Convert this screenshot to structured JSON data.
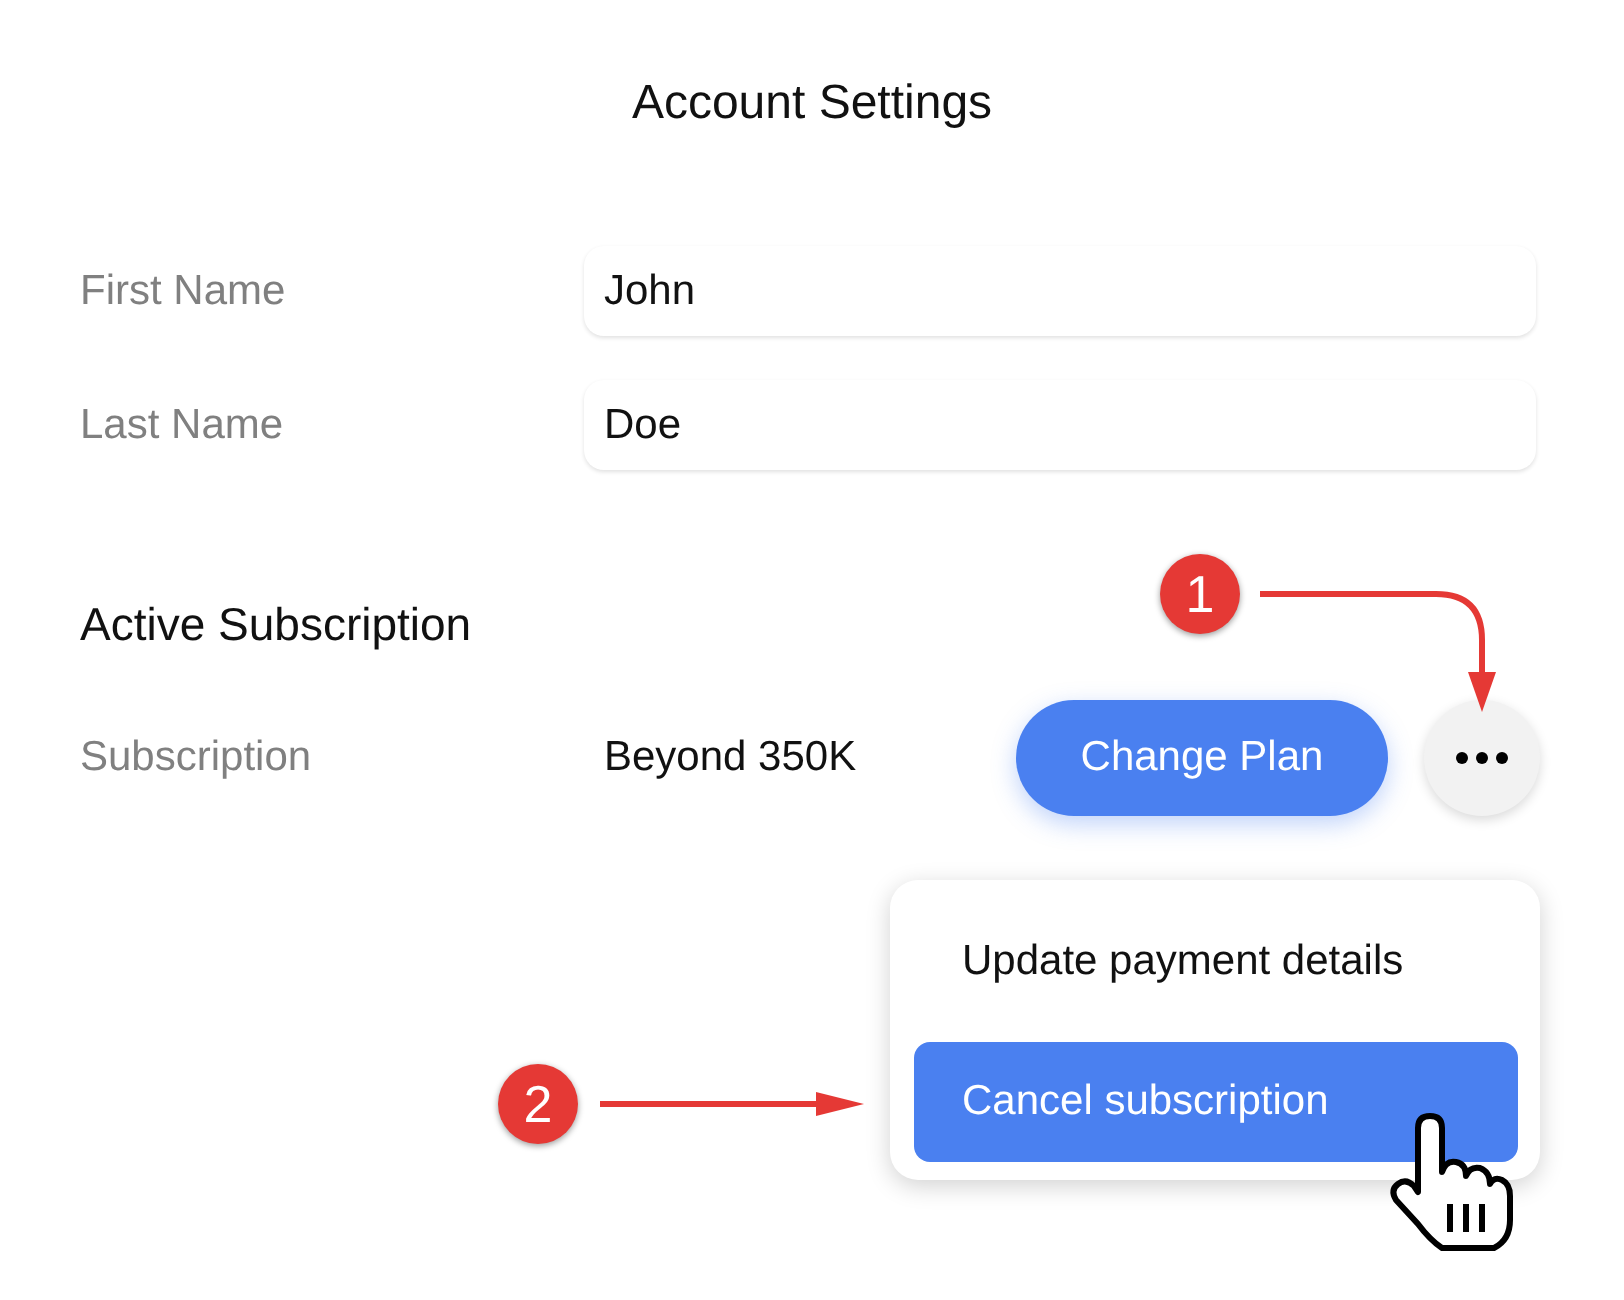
{
  "title": "Account Settings",
  "fields": [
    {
      "label": "First Name",
      "value": "John"
    },
    {
      "label": "Last Name",
      "value": "Doe"
    }
  ],
  "section_title": "Active Subscription",
  "subscription": {
    "label": "Subscription",
    "value": "Beyond 350K",
    "button": "Change Plan"
  },
  "menu": {
    "items": [
      {
        "label": "Update payment details",
        "selected": false
      },
      {
        "label": "Cancel subscription",
        "selected": true
      }
    ]
  },
  "annotations": [
    {
      "number": "1"
    },
    {
      "number": "2"
    }
  ]
}
